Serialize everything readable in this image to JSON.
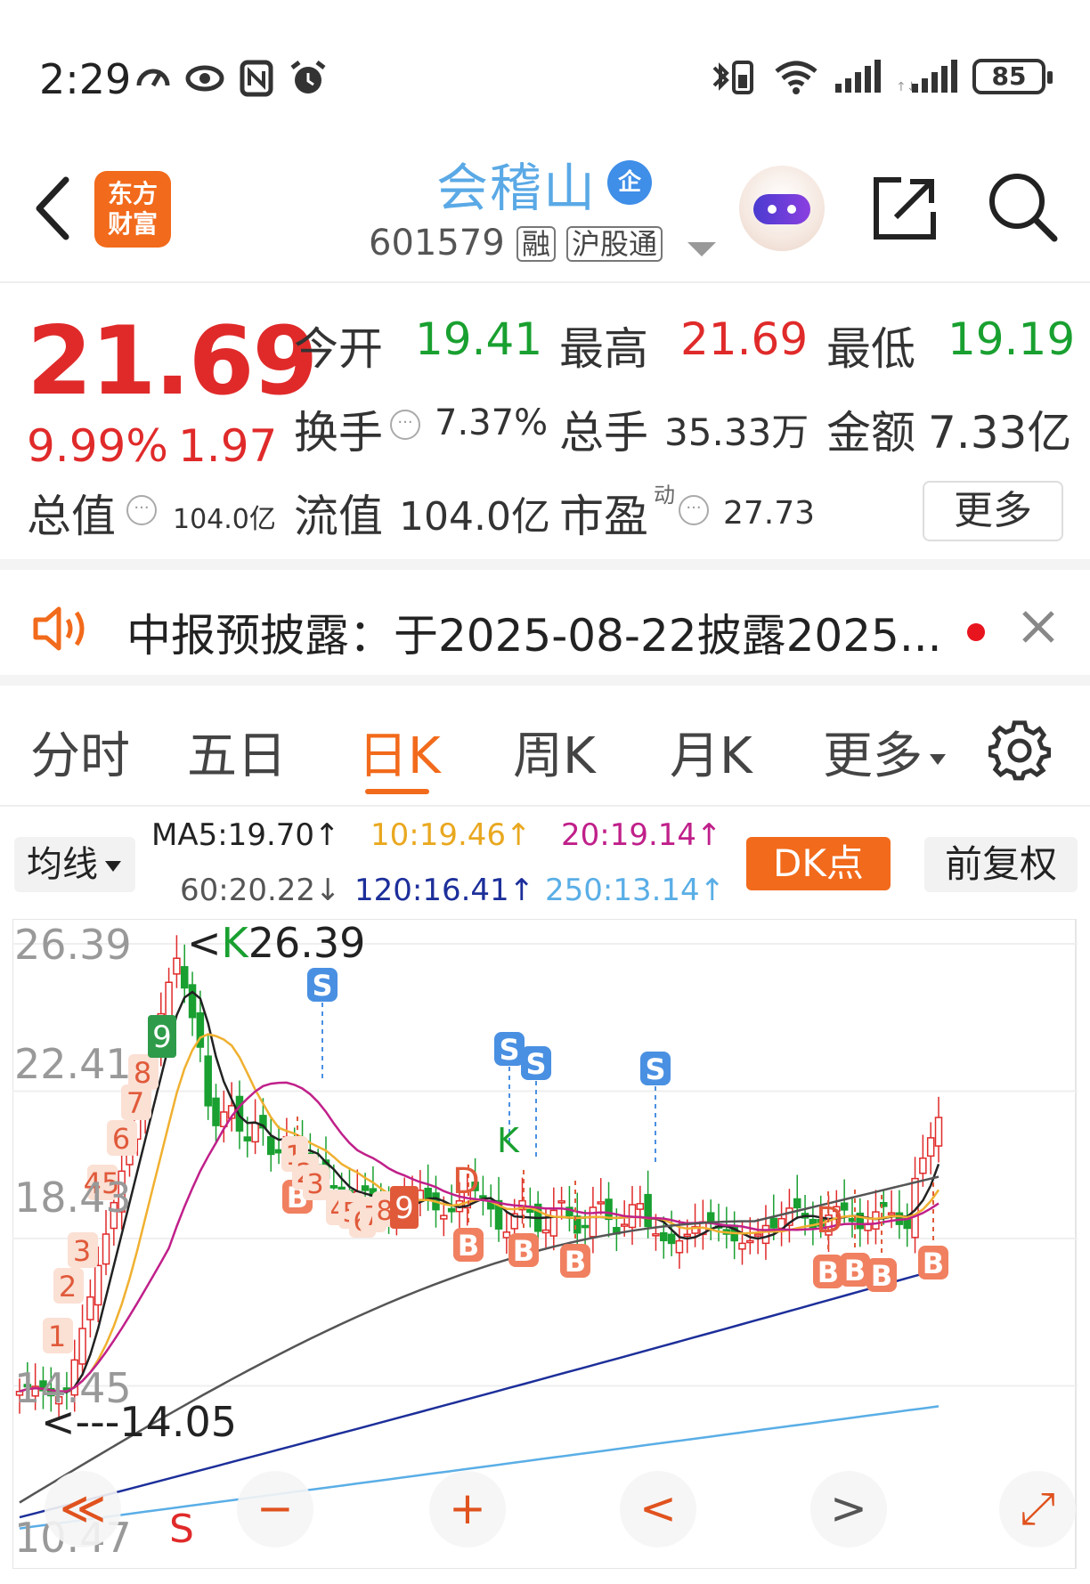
{
  "status_bar": {
    "time": "2:29",
    "battery": "85"
  },
  "header": {
    "logo": "东方\n财富",
    "stock_name": "会稽山",
    "enterprise_badge": "企",
    "stock_code": "601579",
    "tags": [
      "融",
      "沪股通"
    ]
  },
  "quote": {
    "price": "21.69",
    "change_pct": "9.99%",
    "change_val": "1.97",
    "open_label": "今开",
    "open": "19.41",
    "high_label": "最高",
    "high": "21.69",
    "low_label": "最低",
    "low": "19.19",
    "turnover_label": "换手",
    "turnover": "7.37%",
    "volume_label": "总手",
    "volume": "35.33万",
    "amount_label": "金额",
    "amount": "7.33亿",
    "mktcap_label": "总值",
    "mktcap": "104.0亿",
    "float_label": "流值",
    "float": "104.0亿",
    "pe_label": "市盈",
    "pe_sup": "动",
    "pe": "27.73",
    "more": "更多"
  },
  "notice": {
    "text": "中报预披露：于2025-08-22披露2025..."
  },
  "tabs": [
    {
      "label": "分时"
    },
    {
      "label": "五日"
    },
    {
      "label": "日K"
    },
    {
      "label": "周K"
    },
    {
      "label": "月K"
    },
    {
      "label": "更多"
    }
  ],
  "ma_legend": {
    "select": "均线",
    "ma5": "MA5:19.70↑",
    "ma10": "10:19.46↑",
    "ma20": "20:19.14↑",
    "ma60": "60:20.22↓",
    "ma120": "120:16.41↑",
    "ma250": "250:13.14↑",
    "dk_button": "DK点",
    "adjust_button": "前复权",
    "colors": {
      "ma5": "#222222",
      "ma10": "#f0b030",
      "ma20": "#c0208a",
      "ma60": "#555555",
      "ma120": "#1d2f9a",
      "ma250": "#5aaee6"
    }
  },
  "chart_data": {
    "type": "candlestick",
    "y_ticks": [
      "26.39",
      "22.41",
      "18.43",
      "14.45",
      "10.47"
    ],
    "ylim": [
      10.47,
      26.39
    ],
    "high_marker": "K26.39",
    "low_marker": "<---14.05",
    "up_color": "#e02a2a",
    "down_color": "#19a030",
    "signal_labels": {
      "sell": "S",
      "buy": "B",
      "d": "D",
      "k": "K",
      "nine": "9",
      "counts_up": [
        "1",
        "2",
        "3",
        "45",
        "6",
        "7",
        "8"
      ],
      "counts_down": [
        "1",
        "2",
        "3",
        "4",
        "5",
        "6",
        "7",
        "8"
      ]
    }
  },
  "controls": {
    "rewind": "≪",
    "zoom_out": "−",
    "zoom_in": "+",
    "prev": "<",
    "next": ">",
    "expand": "⤢"
  }
}
